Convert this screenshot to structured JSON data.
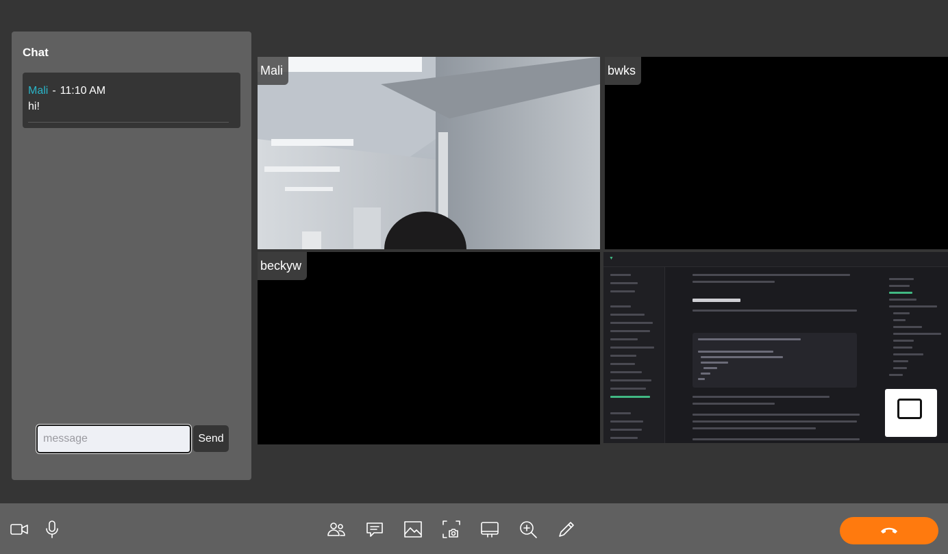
{
  "chat": {
    "title": "Chat",
    "messages": [
      {
        "user": "Mali",
        "separator": "-",
        "time": "11:10 AM",
        "text": "hi!"
      }
    ],
    "input_placeholder": "message",
    "send_label": "Send"
  },
  "participants": [
    {
      "name": "Mali",
      "stream": "camera"
    },
    {
      "name": "bwks",
      "stream": "none"
    },
    {
      "name": "beckyw",
      "stream": "none"
    },
    {
      "name": "",
      "stream": "screen-share"
    }
  ],
  "toolbar": {
    "left": [
      "video-camera-icon",
      "microphone-icon"
    ],
    "center": [
      "participants-icon",
      "chat-icon",
      "image-icon",
      "screenshot-icon",
      "screen-share-icon",
      "zoom-in-icon",
      "pen-icon"
    ],
    "end_call": "hang-up-icon"
  },
  "colors": {
    "background": "#353535",
    "panel": "#606060",
    "username": "#2ab5c8",
    "end_call": "#ff7a0e"
  }
}
